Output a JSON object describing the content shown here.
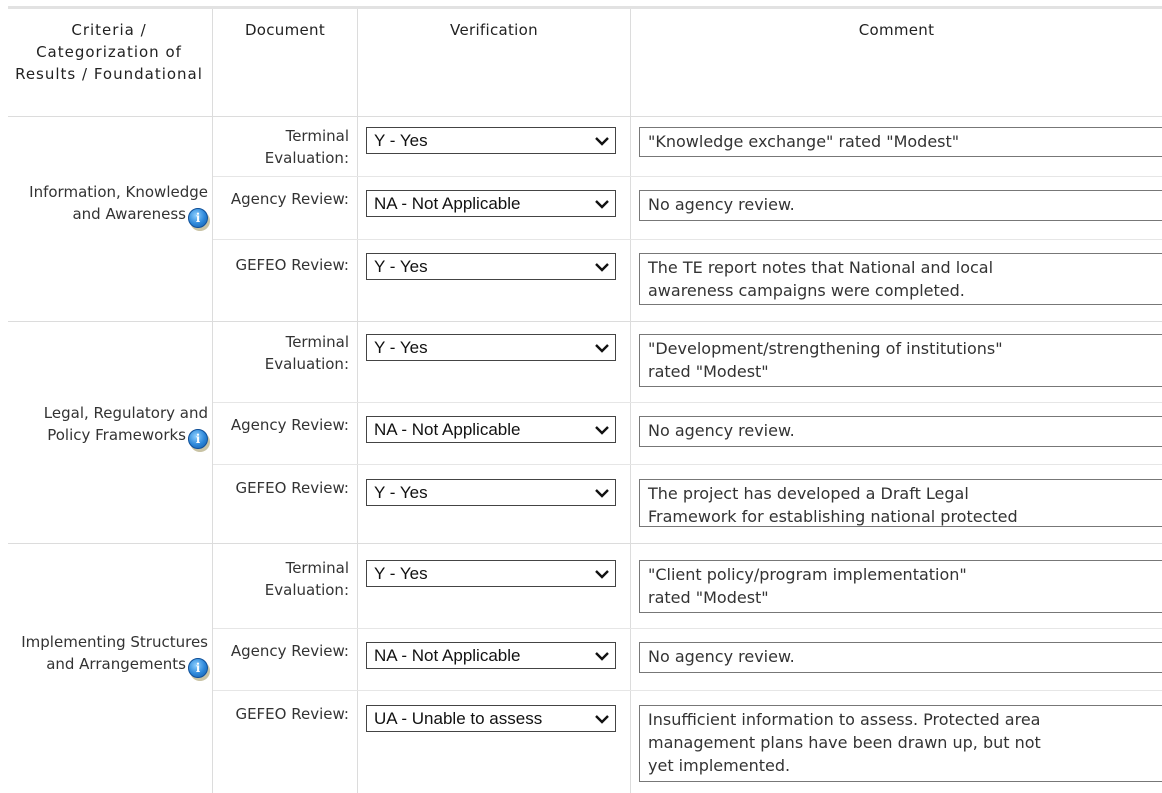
{
  "headers": {
    "criteria": "Criteria / Categorization of Results / Foundational",
    "document": "Document",
    "verification": "Verification",
    "comment": "Comment"
  },
  "doc_labels": {
    "terminal": "Terminal Evaluation:",
    "agency": "Agency Review:",
    "gefeo": "GEFEO Review:"
  },
  "groups": [
    {
      "criteria": "Information, Knowledge and Awareness",
      "rows": [
        {
          "verification": "Y - Yes",
          "comment": "\"Knowledge exchange\" rated \"Modest\""
        },
        {
          "verification": "NA - Not Applicable",
          "comment": "No agency review."
        },
        {
          "verification": "Y - Yes",
          "comment": "The TE report notes that National and local\nawareness campaigns were completed."
        }
      ]
    },
    {
      "criteria": "Legal, Regulatory and Policy Frameworks",
      "rows": [
        {
          "verification": "Y - Yes",
          "comment": "\"Development/strengthening of institutions\"\nrated \"Modest\""
        },
        {
          "verification": "NA - Not Applicable",
          "comment": "No agency review."
        },
        {
          "verification": "Y - Yes",
          "comment": "The project has developed a Draft Legal\nFramework for establishing national protected"
        }
      ]
    },
    {
      "criteria": "Implementing Structures and Arrangements",
      "rows": [
        {
          "verification": "Y - Yes",
          "comment": "\"Client policy/program implementation\"\nrated \"Modest\""
        },
        {
          "verification": "NA - Not Applicable",
          "comment": "No agency review."
        },
        {
          "verification": "UA - Unable to assess",
          "comment": "Insufficient information to assess. Protected area\nmanagement plans have been drawn up, but not\nyet implemented."
        }
      ]
    }
  ],
  "icons": {
    "info": "info-icon",
    "dropdown": "chevron-down-icon"
  },
  "colors": {
    "info_icon": "#2b86d8",
    "border": "#dcdcdc"
  }
}
